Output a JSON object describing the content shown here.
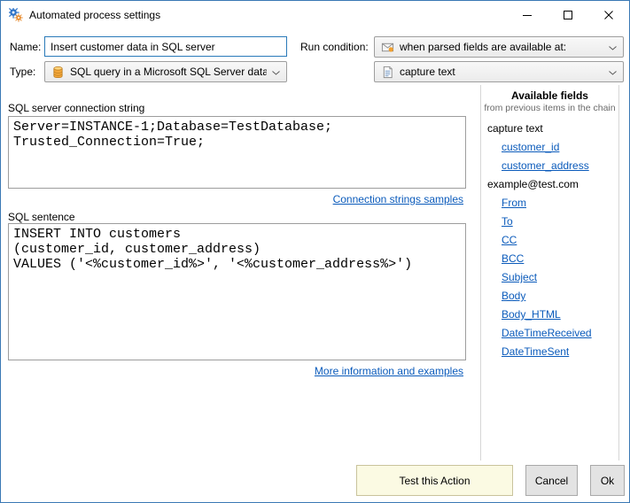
{
  "window": {
    "title": "Automated process settings"
  },
  "form": {
    "name_label": "Name:",
    "name_value": "Insert customer data in SQL server",
    "type_label": "Type:",
    "type_value": "SQL query in a Microsoft SQL Server datab",
    "run_condition_label": "Run condition:",
    "run_condition_value": "when parsed fields are available at:",
    "second_condition_value": "capture text"
  },
  "connection_section": {
    "label": "SQL server connection string",
    "value": "Server=INSTANCE-1;Database=TestDatabase;\nTrusted_Connection=True;",
    "link": "Connection strings samples"
  },
  "sql_section": {
    "label": "SQL sentence",
    "value": "INSERT INTO customers\n(customer_id, customer_address)\nVALUES ('<%customer_id%>', '<%customer_address%>')",
    "link": "More information and examples"
  },
  "available_fields": {
    "title": "Available fields",
    "subtitle": "from previous items in the chain",
    "groups": [
      {
        "header": "capture text",
        "fields": [
          "customer_id",
          "customer_address"
        ]
      },
      {
        "header": "example@test.com",
        "fields": [
          "From",
          "To",
          "CC",
          "BCC",
          "Subject",
          "Body",
          "Body_HTML",
          "DateTimeReceived",
          "DateTimeSent"
        ]
      }
    ]
  },
  "footer": {
    "test_button": "Test this Action",
    "cancel_button": "Cancel",
    "ok_button": "Ok"
  },
  "icons": {
    "app": "gear-icon",
    "run_condition": "parsed-fields-icon",
    "type": "database-icon",
    "capture": "document-icon"
  },
  "colors": {
    "focus_border": "#2a7ab9",
    "link": "#0b5bbb",
    "test_button_bg": "#fbfae3"
  }
}
